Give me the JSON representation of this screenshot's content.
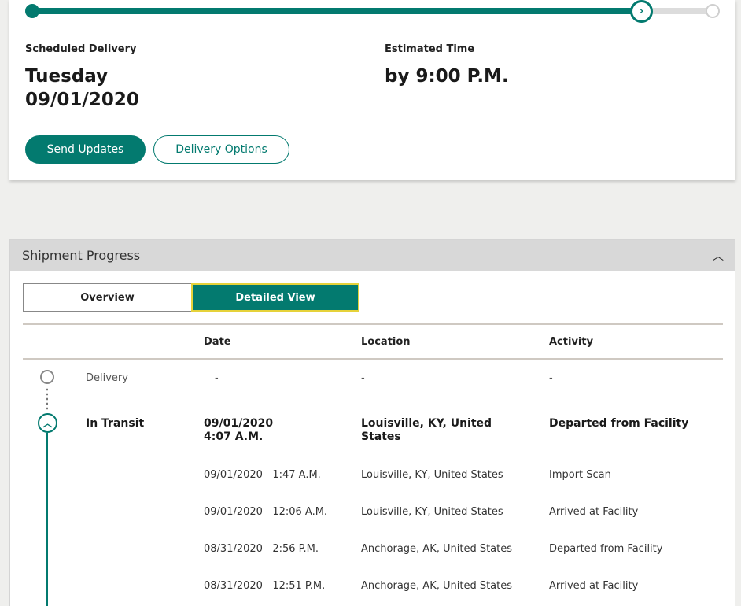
{
  "delivery": {
    "scheduled_label": "Scheduled Delivery",
    "scheduled_day": "Tuesday",
    "scheduled_date": "09/01/2020",
    "estimated_label": "Estimated Time",
    "estimated_value": "by 9:00 P.M.",
    "send_updates_label": "Send Updates",
    "delivery_options_label": "Delivery Options",
    "current_marker_glyph": "›"
  },
  "progress": {
    "title": "Shipment Progress",
    "collapse_glyph": "︿",
    "tabs": {
      "overview": "Overview",
      "detailed": "Detailed View"
    },
    "columns": {
      "date": "Date",
      "location": "Location",
      "activity": "Activity"
    },
    "current_glyph": "︿",
    "rows": [
      {
        "status": "Delivery",
        "date": "-",
        "location": "-",
        "activity": "-"
      },
      {
        "status": "In Transit",
        "date_line1": "09/01/2020",
        "date_line2": "4:07 A.M.",
        "location_line1": "Louisville, KY, United",
        "location_line2": "States",
        "activity": "Departed from Facility"
      },
      {
        "date": "09/01/2020   1:47 A.M.",
        "location": "Louisville, KY, United States",
        "activity": "Import Scan"
      },
      {
        "date": "09/01/2020   12:06 A.M.",
        "location": "Louisville, KY, United States",
        "activity": "Arrived at Facility"
      },
      {
        "date": "08/31/2020   2:56 P.M.",
        "location": "Anchorage, AK, United States",
        "activity": "Departed from Facility"
      },
      {
        "date": "08/31/2020   12:51 P.M.",
        "location": "Anchorage, AK, United States",
        "activity": "Arrived at Facility"
      }
    ]
  },
  "colors": {
    "accent": "#037a6f",
    "highlight_border": "#e6d23a",
    "page_bg": "#efefed"
  }
}
